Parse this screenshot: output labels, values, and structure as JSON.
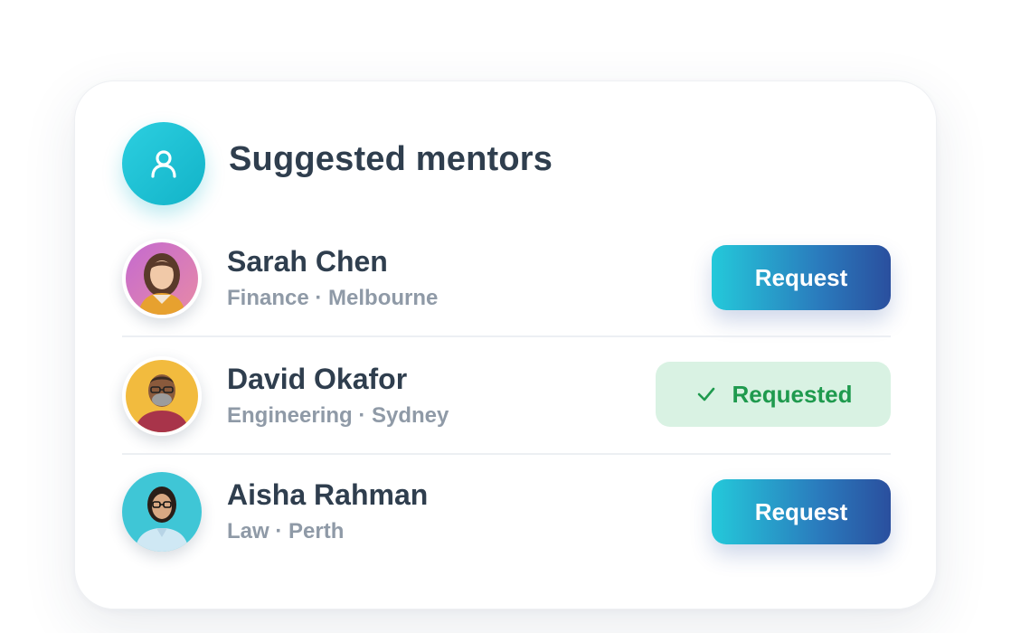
{
  "header": {
    "title": "Suggested mentors",
    "icon": "user-icon"
  },
  "mentors": [
    {
      "name": "Sarah Chen",
      "field": "Finance",
      "separator": "·",
      "city": "Melbourne",
      "meta": "Finance · Melbourne",
      "action_label": "Request",
      "status": "request"
    },
    {
      "name": "David Okafor",
      "field": "Engineering",
      "separator": "·",
      "city": "Sydney",
      "meta": "Engineering · Sydney",
      "action_label": "Requested",
      "status": "requested"
    },
    {
      "name": "Aisha Rahman",
      "field": "Law",
      "separator": "·",
      "city": "Perth",
      "meta": "Law · Perth",
      "action_label": "Request",
      "status": "request"
    }
  ],
  "colors": {
    "accent_teal": "#1cc0d4",
    "button_gradient_start": "#24c9da",
    "button_gradient_end": "#2a4f9e",
    "requested_bg": "#d9f2e3",
    "requested_text": "#1f9a4e",
    "title_text": "#2f3e4e",
    "meta_text": "#8f9aa7"
  }
}
